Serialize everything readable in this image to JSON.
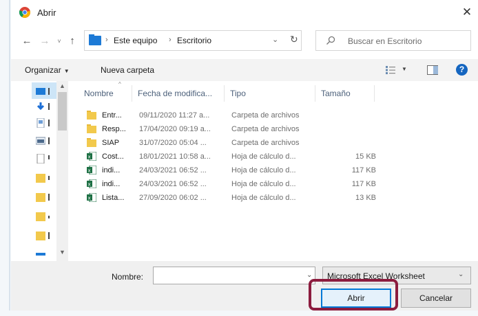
{
  "window": {
    "title": "Abrir",
    "close_glyph": "✕",
    "app_icon": "chrome-icon"
  },
  "nav": {
    "back": "←",
    "forward": "→",
    "recent": "˅",
    "up": "↑"
  },
  "address": {
    "separator": "›",
    "crumbs": [
      "Este equipo",
      "Escritorio"
    ],
    "dropdown": "⌄",
    "refresh": "↻"
  },
  "search": {
    "placeholder": "Buscar en Escritorio"
  },
  "commands": {
    "organize": "Organizar",
    "new_folder": "Nueva carpeta",
    "help": "?"
  },
  "columns": {
    "name": "Nombre",
    "date": "Fecha de modifica...",
    "type": "Tipo",
    "size": "Tamaño"
  },
  "files": [
    {
      "name": "Entr...",
      "date": "09/11/2020 11:27 a...",
      "type": "Carpeta de archivos",
      "size": "",
      "icon": "folder-icon"
    },
    {
      "name": "Resp...",
      "date": "17/04/2020 09:19 a...",
      "type": "Carpeta de archivos",
      "size": "",
      "icon": "folder-icon"
    },
    {
      "name": "SIAP",
      "date": "31/07/2020 05:04 ...",
      "type": "Carpeta de archivos",
      "size": "",
      "icon": "folder-icon"
    },
    {
      "name": "Cost...",
      "date": "18/01/2021 10:58 a...",
      "type": "Hoja de cálculo d...",
      "size": "15 KB",
      "icon": "excel-icon"
    },
    {
      "name": "indi...",
      "date": "24/03/2021 06:52 ...",
      "type": "Hoja de cálculo d...",
      "size": "117 KB",
      "icon": "excel-icon"
    },
    {
      "name": "indi...",
      "date": "24/03/2021 06:52 ...",
      "type": "Hoja de cálculo d...",
      "size": "117 KB",
      "icon": "excel-icon"
    },
    {
      "name": "Lista...",
      "date": "27/09/2020 06:02 ...",
      "type": "Hoja de cálculo d...",
      "size": "13 KB",
      "icon": "excel-icon"
    }
  ],
  "footer": {
    "filename_label": "Nombre:",
    "filename_value": "",
    "filetype": "Microsoft Excel Worksheet",
    "open_button": "Abrir",
    "cancel_button": "Cancelar"
  },
  "colors": {
    "accent": "#0078d7",
    "highlight": "#8c1c3e",
    "folder": "#f2c94c",
    "excel": "#1d7044"
  }
}
